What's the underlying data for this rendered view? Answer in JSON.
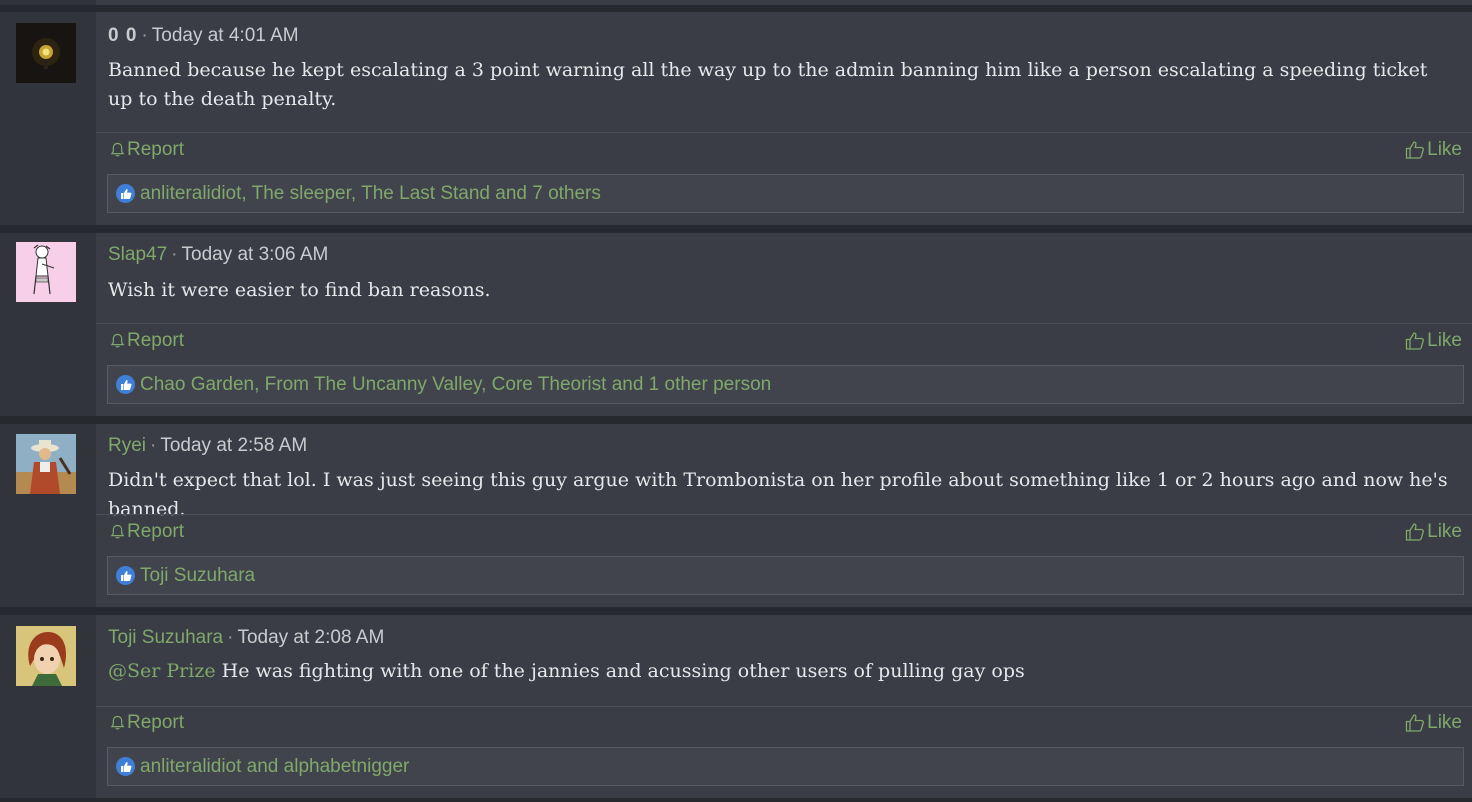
{
  "posts": [
    {
      "author": "0 0",
      "time": "Today at 4:01 AM",
      "message": "Banned because he kept escalating a 3 point warning all the way up to the admin banning him like a person escalating a speeding ticket up to the death penalty.",
      "report_label": "Report",
      "like_label": "Like",
      "reactions": "anliteralidiot, The sleeper, The Last Stand and 7 others"
    },
    {
      "author": "Slap47",
      "time": "Today at 3:06 AM",
      "message": "Wish it were easier to find ban reasons.",
      "report_label": "Report",
      "like_label": "Like",
      "reactions": "Chao Garden, From The Uncanny Valley, Core Theorist and 1 other person"
    },
    {
      "author": "Ryei",
      "time": "Today at 2:58 AM",
      "message": "Didn't expect that lol. I was just seeing this guy argue with Trombonista on her profile about something like 1 or 2 hours ago and now he's banned.",
      "report_label": "Report",
      "like_label": "Like",
      "reactions": "Toji Suzuhara"
    },
    {
      "author": "Toji Suzuhara",
      "time": "Today at 2:08 AM",
      "mention": "@Ser Prize",
      "message": " He was fighting with one of the jannies and acussing other users of pulling gay ops",
      "report_label": "Report",
      "like_label": "Like",
      "reactions": "anliteralidiot and alphabetnigger"
    }
  ],
  "separator": "·",
  "colors": {
    "accent": "#7fa86a",
    "background": "#3a3d45",
    "user_column": "#31343b",
    "reaction_icon": "#3f7fd8"
  }
}
